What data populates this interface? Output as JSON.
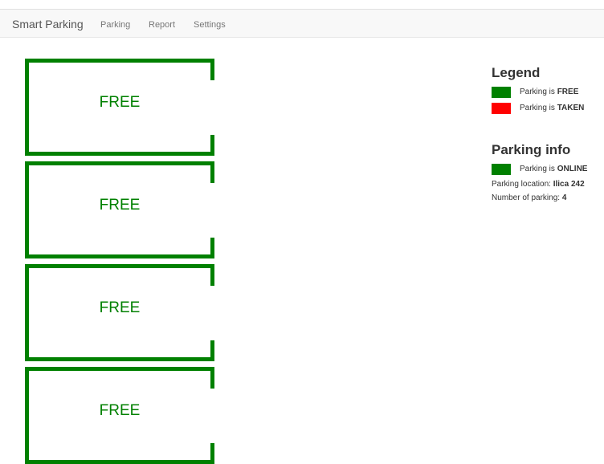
{
  "navbar": {
    "brand": "Smart Parking",
    "links": [
      "Parking",
      "Report",
      "Settings"
    ]
  },
  "colors": {
    "free": "#008000",
    "taken": "#ff0000",
    "online": "#008000"
  },
  "spots": [
    {
      "label": "FREE",
      "status": "free"
    },
    {
      "label": "FREE",
      "status": "free"
    },
    {
      "label": "FREE",
      "status": "free"
    },
    {
      "label": "FREE",
      "status": "free"
    }
  ],
  "legend": {
    "title": "Legend",
    "free_prefix": "Parking is",
    "free_value": "FREE",
    "taken_prefix": "Parking is",
    "taken_value": "TAKEN"
  },
  "parking_info": {
    "title": "Parking info",
    "status_prefix": "Parking is",
    "status_value": "ONLINE",
    "location_label": "Parking location:",
    "location_value": "Ilica 242",
    "count_label": "Number of parking:",
    "count_value": "4"
  }
}
